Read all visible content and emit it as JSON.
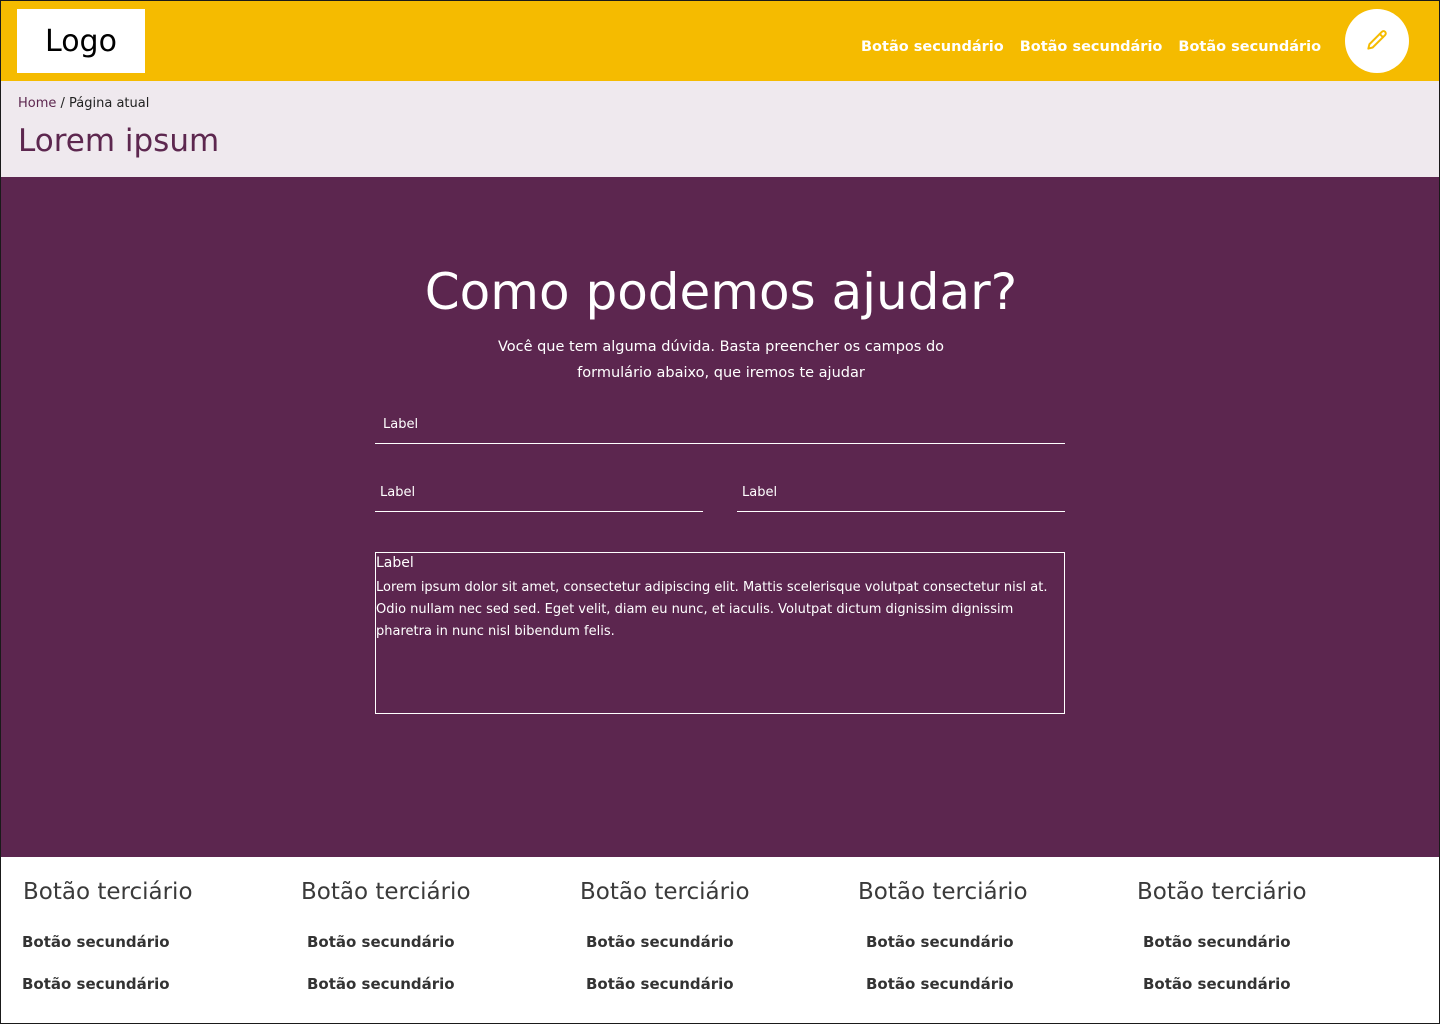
{
  "header": {
    "logo": "Logo",
    "nav": [
      "Botão secundário",
      "Botão secundário",
      "Botão secundário"
    ],
    "edit_icon": "pencil-icon",
    "accent": "#f5bb00"
  },
  "breadcrumb": {
    "home": "Home",
    "separator": " / ",
    "current": "Página atual"
  },
  "page_title": "Lorem ipsum",
  "hero": {
    "title": "Como podemos ajudar?",
    "subtitle": "Você que tem alguma dúvida. Basta preencher os campos do formulário abaixo, que iremos te ajudar",
    "background": "#5c264f",
    "fields": [
      {
        "label": "Label"
      },
      {
        "label": "Label"
      },
      {
        "label": "Label"
      }
    ],
    "textarea": {
      "label": "Label",
      "value": "Lorem ipsum dolor sit amet, consectetur adipiscing elit. Mattis scelerisque volutpat consectetur nisl at. Odio nullam nec sed sed. Eget velit, diam eu nunc, et iaculis. Volutpat dictum dignissim dignissim pharetra in nunc nisl bibendum felis."
    }
  },
  "footer": {
    "columns": [
      {
        "title": "Botão terciário",
        "links": [
          "Botão secundário",
          "Botão secundário"
        ]
      },
      {
        "title": "Botão terciário",
        "links": [
          "Botão secundário",
          "Botão secundário"
        ]
      },
      {
        "title": "Botão terciário",
        "links": [
          "Botão secundário",
          "Botão secundário"
        ]
      },
      {
        "title": "Botão terciário",
        "links": [
          "Botão secundário",
          "Botão secundário"
        ]
      },
      {
        "title": "Botão terciário",
        "links": [
          "Botão secundário",
          "Botão secundário"
        ]
      }
    ]
  }
}
